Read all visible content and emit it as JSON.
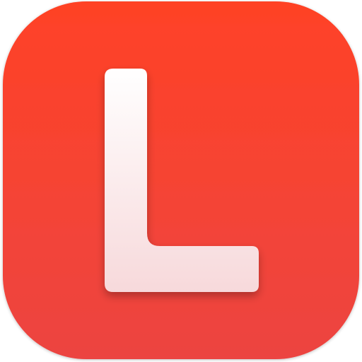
{
  "app_icon": {
    "icon_name": "letter-l-app-icon",
    "colors": {
      "background_top": "#FF3A1E",
      "background_bottom": "#EC3E3A",
      "glyph_top": "#FFFFFF",
      "glyph_bottom": "#F7D9DB"
    }
  }
}
